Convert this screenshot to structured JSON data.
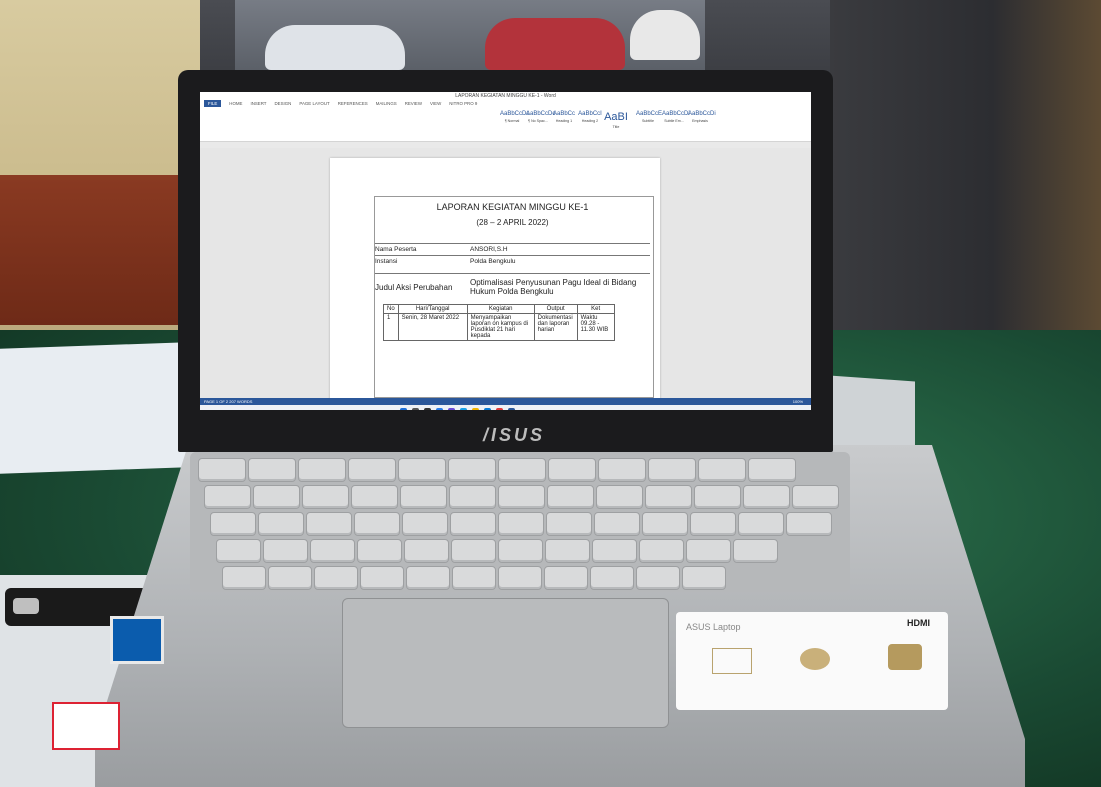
{
  "word": {
    "window_title": "LAPORAN KEGIATAN MINGGU KE-1 - Word",
    "tabs": [
      "FILE",
      "HOME",
      "INSERT",
      "DESIGN",
      "PAGE LAYOUT",
      "REFERENCES",
      "MAILINGS",
      "REVIEW",
      "VIEW",
      "NITRO PRO 9"
    ],
    "styles": [
      {
        "sample": "AaBbCcDc",
        "name": "¶ Normal"
      },
      {
        "sample": "AaBbCcDc",
        "name": "¶ No Spac..."
      },
      {
        "sample": "AaBbCc",
        "name": "Heading 1"
      },
      {
        "sample": "AaBbCcI",
        "name": "Heading 2"
      },
      {
        "sample": "AaBI",
        "name": "Title"
      },
      {
        "sample": "AaBbCcE",
        "name": "Subtitle"
      },
      {
        "sample": "AaBbCcDi",
        "name": "Subtle Em..."
      },
      {
        "sample": "AaBbCcDi",
        "name": "Emphasis"
      }
    ],
    "status": "PAGE 1 OF 2    207 WORDS",
    "zoom": "100%"
  },
  "document": {
    "title": "LAPORAN KEGIATAN MINGGU KE-1",
    "date_range": "(28 – 2 APRIL 2022)",
    "fields": [
      {
        "label": "Nama Peserta",
        "value": "ANSORI,S.H"
      },
      {
        "label": "Instansi",
        "value": "Polda Bengkulu"
      }
    ],
    "aksi_label": "Judul Aksi Perubahan",
    "aksi_value": "Optimalisasi Penyusunan Pagu Ideal di Bidang Hukum Polda Bengkulu",
    "table_headers": [
      "No",
      "Hari/Tanggal",
      "Kegiatan",
      "Output",
      "Ket"
    ],
    "table_rows": [
      {
        "no": "1",
        "date": "Senin, 28 Maret 2022",
        "kegiatan": "Menyampaikan laporan on kampus di Pusdiklat 21 hari kepada",
        "output": "Dokumentasi dan laporan harian",
        "ket": "Waktu 09.28 - 11.30 WIB"
      }
    ]
  },
  "laptop": {
    "brand": "/ISUS",
    "sticker_title": "ASUS Laptop",
    "sticker_badge": "HDMI"
  }
}
